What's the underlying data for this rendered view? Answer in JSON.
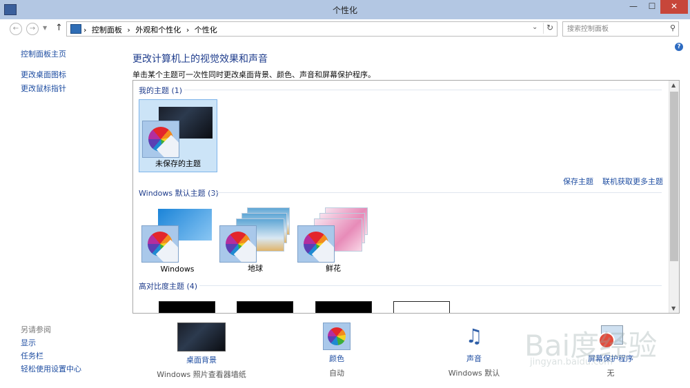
{
  "window": {
    "title": "个性化",
    "min": "—",
    "max": "☐",
    "close": "✕"
  },
  "addressbar": {
    "breadcrumb": [
      "控制面板",
      "外观和个性化",
      "个性化"
    ],
    "separator": "›",
    "search_placeholder": "搜索控制面板"
  },
  "sidebar": {
    "links": [
      "控制面板主页",
      "更改桌面图标",
      "更改鼠标指针"
    ],
    "see_also_title": "另请参阅",
    "see_also": [
      "显示",
      "任务栏",
      "轻松使用设置中心"
    ]
  },
  "main": {
    "heading": "更改计算机上的视觉效果和声音",
    "subheading": "单击某个主题可一次性同时更改桌面背景、颜色、声音和屏幕保护程序。",
    "my_themes": {
      "title": "我的主题 (1)",
      "items": [
        "未保存的主题"
      ]
    },
    "save_theme": "保存主题",
    "get_more": "联机获取更多主题",
    "windows_themes": {
      "title": "Windows 默认主题 (3)",
      "items": [
        "Windows",
        "地球",
        "鲜花"
      ]
    },
    "high_contrast": {
      "title": "高对比度主题 (4)"
    }
  },
  "bottom": [
    {
      "name": "桌面背景",
      "value": "Windows 照片查看器墙纸"
    },
    {
      "name": "颜色",
      "value": "自动"
    },
    {
      "name": "声音",
      "value": "Windows 默认"
    },
    {
      "name": "屏幕保护程序",
      "value": "无"
    }
  ],
  "watermark": {
    "main": "Bai度经验",
    "sub": "jingyan.baidu.com"
  }
}
